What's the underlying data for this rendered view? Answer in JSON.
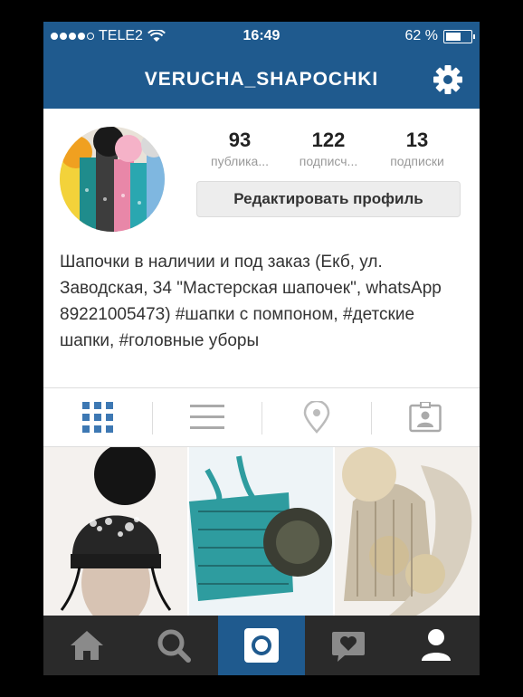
{
  "status_bar": {
    "carrier": "TELE2",
    "time": "16:49",
    "battery": "62 %",
    "battery_level": 0.62
  },
  "header": {
    "username": "VERUCHA_SHAPOCHKI",
    "settings_icon": "gear-icon"
  },
  "profile": {
    "stats": [
      {
        "count": "93",
        "label": "публика..."
      },
      {
        "count": "122",
        "label": "подписч..."
      },
      {
        "count": "13",
        "label": "подписки"
      }
    ],
    "edit_button": "Редактировать профиль",
    "bio": "Шапочки в наличии и под заказ (Екб, ул. Заводская, 34 \"Мастерская шапочек\", whatsApp 89221005473) #шапки с помпоном, #детские шапки, #головные уборы"
  },
  "view_tabs": [
    {
      "icon": "grid-icon",
      "active": true
    },
    {
      "icon": "list-icon",
      "active": false
    },
    {
      "icon": "location-pin-icon",
      "active": false
    },
    {
      "icon": "tagged-person-icon",
      "active": false
    }
  ],
  "posts": [
    {
      "desc": "black knit hat with fur pompom and rhinestone flowers"
    },
    {
      "desc": "teal beaded knit hat with fur pompom"
    },
    {
      "desc": "beige knit hat with scarf and fur pompoms"
    }
  ],
  "bottom_tabs": [
    {
      "icon": "home-icon",
      "active": false
    },
    {
      "icon": "search-icon",
      "active": false
    },
    {
      "icon": "camera-icon",
      "active": true
    },
    {
      "icon": "activity-heart-icon",
      "active": false
    },
    {
      "icon": "profile-icon",
      "active": true
    }
  ],
  "colors": {
    "brand_blue": "#1f5a8e",
    "active_tab": "#3d78b3",
    "inactive_icon": "#aaaaaa",
    "tab_bar": "#2a2a2a"
  }
}
